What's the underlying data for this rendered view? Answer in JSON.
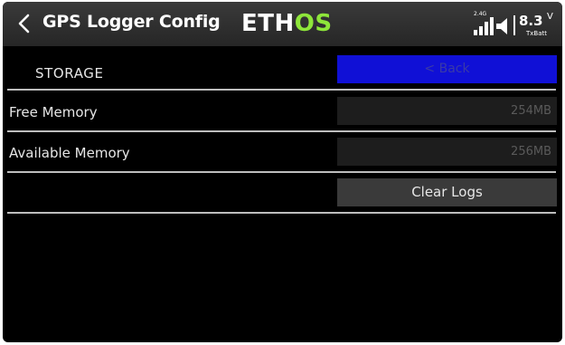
{
  "header": {
    "title": "GPS Logger Config",
    "logo_part1": "ETH",
    "logo_part2": "OS",
    "status": {
      "signal_band": "2.4G",
      "battery_value": "8.3",
      "battery_unit": "V",
      "battery_label": "TxBatt"
    }
  },
  "content": {
    "section_title": "STORAGE",
    "back_button": "< Back",
    "rows": [
      {
        "label": "Free Memory",
        "value": "254MB"
      },
      {
        "label": "Available Memory",
        "value": "256MB"
      }
    ],
    "clear_button": "Clear Logs"
  },
  "colors": {
    "logo_green": "#8ee63a",
    "back_button_bg": "#1010d6",
    "button_bg": "#3a3a3a",
    "field_bg": "#1d1d1d"
  },
  "icons": {
    "back": "chevron-left-icon",
    "signal": "signal-bars-icon",
    "speaker": "speaker-icon"
  }
}
